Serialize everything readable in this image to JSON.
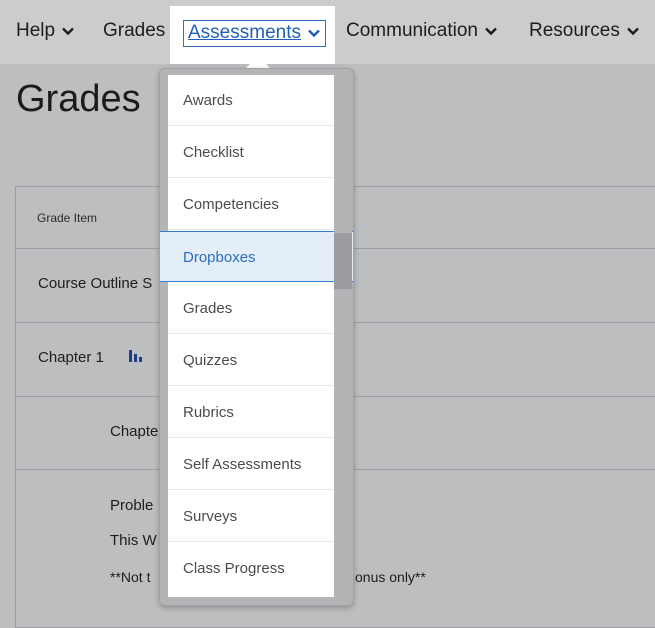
{
  "nav": {
    "items": [
      {
        "label": "Help"
      },
      {
        "label": "Grades"
      },
      {
        "label": "Assessments"
      },
      {
        "label": "Communication"
      },
      {
        "label": "Resources"
      }
    ]
  },
  "page": {
    "title": "Grades"
  },
  "grades_table": {
    "header": "Grade Item",
    "rows": [
      {
        "text": "Course Outline S"
      },
      {
        "text": "Chapter 1"
      },
      {
        "text": "Chapte"
      },
      {
        "text": "Proble"
      },
      {
        "text": "This W"
      },
      {
        "text": "**Not t"
      },
      {
        "text": "onus only**"
      }
    ]
  },
  "dropdown": {
    "items": [
      {
        "label": "Awards"
      },
      {
        "label": "Checklist"
      },
      {
        "label": "Competencies"
      },
      {
        "label": "Dropboxes"
      },
      {
        "label": "Grades"
      },
      {
        "label": "Quizzes"
      },
      {
        "label": "Rubrics"
      },
      {
        "label": "Self Assessments"
      },
      {
        "label": "Surveys"
      },
      {
        "label": "Class Progress"
      }
    ],
    "active_index": 3
  },
  "icons": {
    "chevron": "chevron-down-icon",
    "stats": "bar-chart-icon"
  },
  "colors": {
    "accent": "#2f6fc4",
    "active_bg": "#e3eef8"
  }
}
